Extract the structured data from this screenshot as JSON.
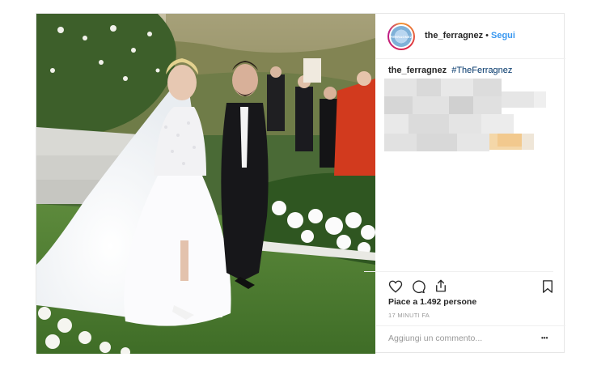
{
  "post": {
    "username": "the_ferragnez",
    "separator": "•",
    "follow_label": "Segui",
    "avatar_text": "FERRAGNEZ",
    "caption_username": "the_ferragnez",
    "caption_hashtag": "#TheFerragnez",
    "likes_text": "Piace a 1.492 persone",
    "time_text": "17 MINUTI FA",
    "comment_placeholder": "Aggiungi un commento...",
    "more_label": "•••"
  },
  "icons": [
    "heart-icon",
    "comment-icon",
    "share-icon",
    "bookmark-icon"
  ],
  "colors": {
    "link": "#3897f0",
    "hashtag": "#003569",
    "muted": "#999999",
    "text": "#262626",
    "border": "#efefef"
  }
}
